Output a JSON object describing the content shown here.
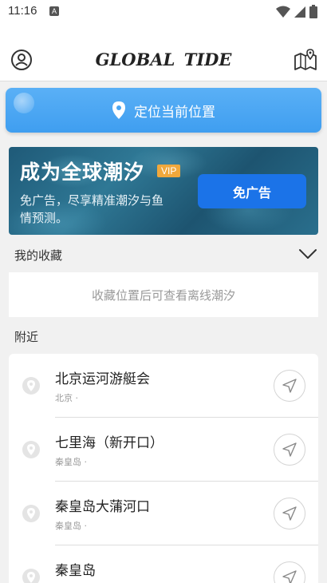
{
  "status_bar": {
    "time": "11:16",
    "notification_badge": "A"
  },
  "header": {
    "logo": "GLOBAL TIDE",
    "profile_icon": "user-circle-icon",
    "map_icon": "map-pin-icon"
  },
  "locate": {
    "label": "定位当前位置"
  },
  "vip_banner": {
    "title": "成为全球潮汐",
    "badge": "VIP",
    "description": "免广告，尽享精准潮汐与鱼情预测。",
    "cta": "免广告"
  },
  "favorites": {
    "title": "我的收藏",
    "empty_text": "收藏位置后可查看离线潮汐"
  },
  "nearby": {
    "title": "附近",
    "stations": [
      {
        "name": "北京运河游艇会",
        "region": "北京 ·"
      },
      {
        "name": "七里海（新开口）",
        "region": "秦皇岛 ·"
      },
      {
        "name": "秦皇岛大蒲河口",
        "region": "秦皇岛 ·"
      },
      {
        "name": "秦皇岛",
        "region": ""
      }
    ]
  },
  "colors": {
    "accent": "#3f9ef0",
    "cta": "#1b73e8",
    "vip": "#f0a83c"
  }
}
